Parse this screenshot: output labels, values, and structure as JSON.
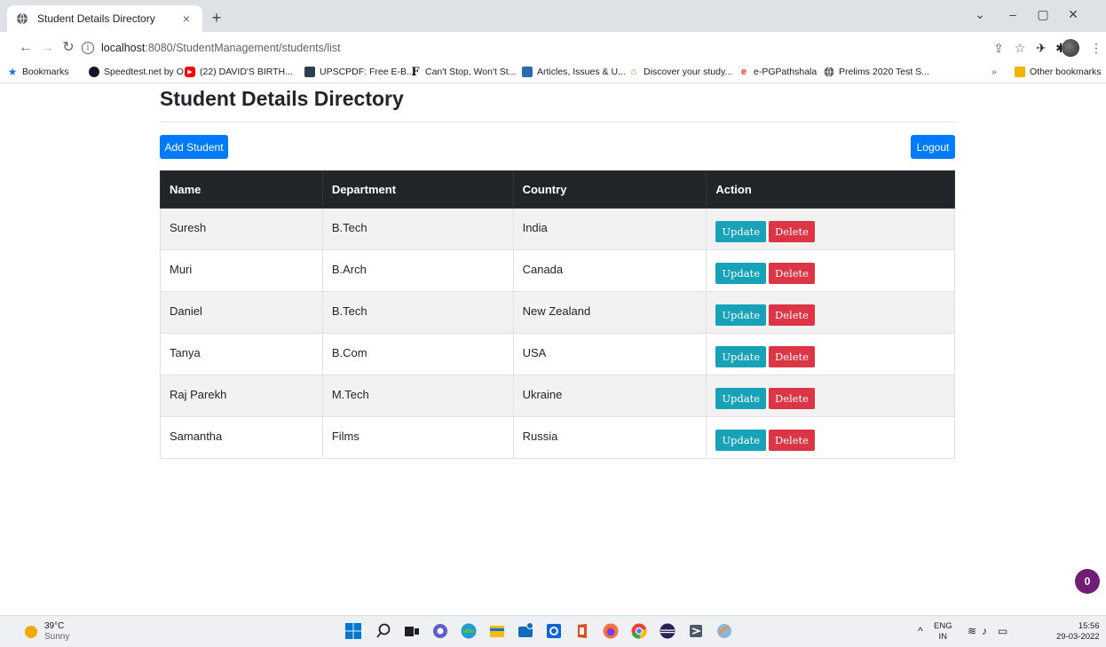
{
  "browser": {
    "tab_title": "Student Details Directory",
    "tab_close": "×",
    "new_tab": "+",
    "url_host": "localhost",
    "url_path": ":8080/StudentManagement/students/list",
    "bookmarks": [
      {
        "label": "Bookmarks",
        "icon": "star-icon",
        "color": "#1a73e8"
      },
      {
        "label": "Speedtest.net by O...",
        "icon": "speedtest-icon",
        "color": "#141526"
      },
      {
        "label": "(22) DAVID'S BIRTH...",
        "icon": "youtube-icon",
        "color": "#ff0000"
      },
      {
        "label": "UPSCPDF: Free E-B...",
        "icon": "upscpdf-icon",
        "color": "#2c3e50"
      },
      {
        "label": "Can't Stop, Won't St...",
        "icon": "font-f-icon",
        "color": "#111111"
      },
      {
        "label": "Articles, Issues & U...",
        "icon": "articles-icon",
        "color": "#2a6bb0"
      },
      {
        "label": "Discover your study...",
        "icon": "temple-icon",
        "color": "#c47a00"
      },
      {
        "label": "e-PGPathshala",
        "icon": "epg-icon",
        "color": "#e53935"
      },
      {
        "label": "Prelims 2020 Test S...",
        "icon": "globe-icon",
        "color": "#5f6368"
      }
    ],
    "more_bookmarks": "»",
    "other_bookmarks": "Other bookmarks"
  },
  "page": {
    "title": "Student Details Directory",
    "add_button": "Add Student",
    "logout_button": "Logout",
    "columns": [
      "Name",
      "Department",
      "Country",
      "Action"
    ],
    "update_label": "Update",
    "delete_label": "Delete",
    "students": [
      {
        "name": "Suresh",
        "department": "B.Tech",
        "country": "India"
      },
      {
        "name": "Muri",
        "department": "B.Arch",
        "country": "Canada"
      },
      {
        "name": "Daniel",
        "department": "B.Tech",
        "country": "New Zealand"
      },
      {
        "name": "Tanya",
        "department": "B.Com",
        "country": "USA"
      },
      {
        "name": "Raj Parekh",
        "department": "M.Tech",
        "country": "Ukraine"
      },
      {
        "name": "Samantha",
        "department": "Films",
        "country": "Russia"
      }
    ],
    "notification_count": "0"
  },
  "colors": {
    "primary": "#007bff",
    "info": "#17a2b8",
    "danger": "#dc3545",
    "table_header": "#212529"
  },
  "taskbar": {
    "temperature": "39°C",
    "weather": "Sunny",
    "language": "ENG",
    "region": "IN",
    "time": "15:56",
    "date": "29-03-2022"
  }
}
